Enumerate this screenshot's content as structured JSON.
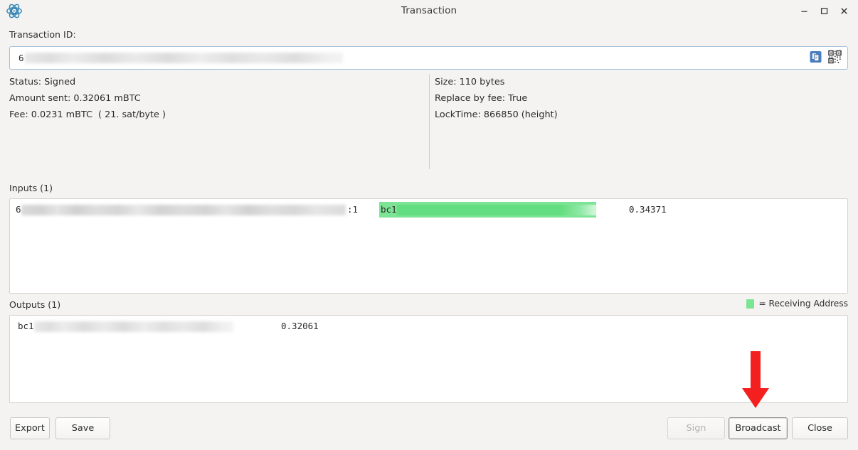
{
  "window": {
    "title": "Transaction",
    "app_icon": "electrum-logo-icon",
    "controls": {
      "minimize": "minimize-icon",
      "maximize": "maximize-icon",
      "close": "close-icon"
    }
  },
  "txid": {
    "label": "Transaction ID:",
    "value_prefix": "6",
    "value_redacted": true,
    "copy_icon": "copy-icon",
    "qr_icon": "qr-code-icon"
  },
  "summary": {
    "left": [
      "Status: Signed",
      "Amount sent: 0.32061 mBTC",
      "Fee: 0.0231 mBTC  ( 21. sat/byte )"
    ],
    "right": [
      "Size: 110 bytes",
      "Replace by fee: True",
      "LockTime: 866850 (height)"
    ]
  },
  "inputs": {
    "title": "Inputs (1)",
    "rows": [
      {
        "txid_prefix": "6",
        "output_index": ":1",
        "address_prefix": "bc1",
        "address_highlighted": true,
        "amount": "0.34371"
      }
    ]
  },
  "outputs": {
    "title": "Outputs (1)",
    "legend": "= Receiving Address",
    "legend_color": "#7ae592",
    "rows": [
      {
        "address_prefix": "bc1",
        "address_highlighted": false,
        "amount": "0.32061"
      }
    ]
  },
  "buttons": {
    "export": "Export",
    "save": "Save",
    "sign": "Sign",
    "broadcast": "Broadcast",
    "close": "Close"
  },
  "annotation": {
    "arrow_color": "#f42020",
    "arrow_target": "broadcast-button"
  },
  "colors": {
    "background": "#f4f3f1",
    "accent_blue": "#3a7cb8",
    "focus_border": "#a6c0da",
    "receiving_green": "#7ae592",
    "annotation_red": "#f42020"
  }
}
